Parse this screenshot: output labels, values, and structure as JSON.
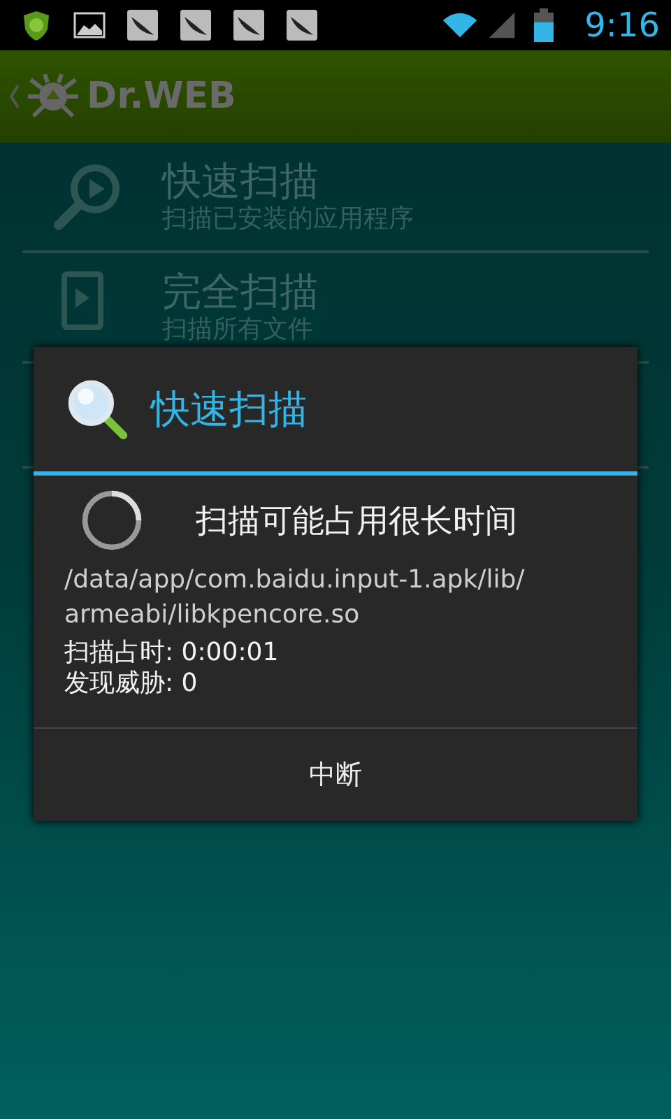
{
  "status_bar": {
    "time": "9:16"
  },
  "action_bar": {
    "title": "Dr.WEB"
  },
  "scan_options": [
    {
      "kind": "quick",
      "title": "快速扫描",
      "subtitle": "扫描已安装的应用程序"
    },
    {
      "kind": "full",
      "title": "完全扫描",
      "subtitle": "扫描所有文件"
    }
  ],
  "dialog": {
    "title": "快速扫描",
    "message": "扫描可能占用很长时间",
    "current_file": "/data/app/com.baidu.input-1.apk/lib/armeabi/libkpencore.so",
    "elapsed": "扫描占时: 0:00:01",
    "threats": "发现威胁: 0",
    "button": "中断"
  }
}
